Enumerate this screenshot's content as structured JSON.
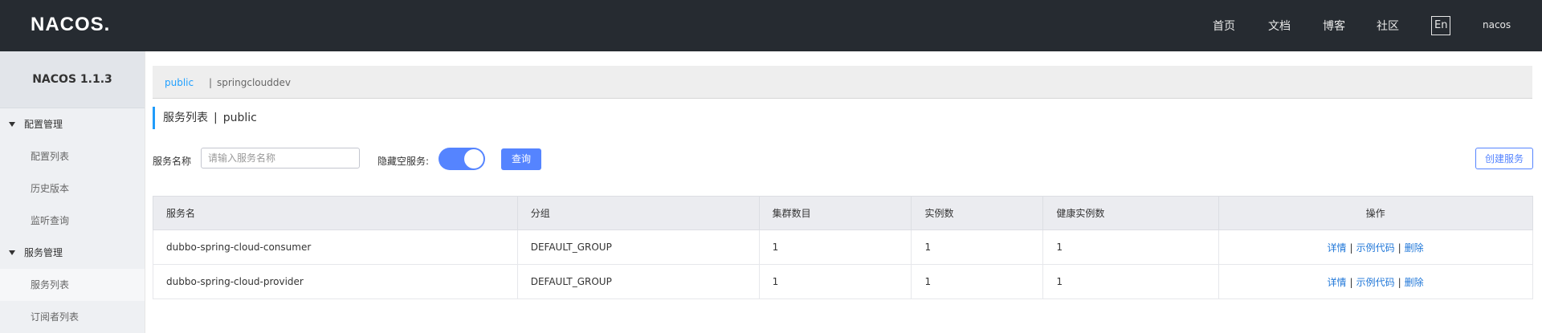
{
  "header": {
    "logo": "NACOS.",
    "nav": [
      "首页",
      "文档",
      "博客",
      "社区"
    ],
    "lang": "En",
    "user": "nacos"
  },
  "sidebar": {
    "brand": "NACOS 1.1.3",
    "groups": [
      {
        "label": "配置管理",
        "items": [
          "配置列表",
          "历史版本",
          "监听查询"
        ]
      },
      {
        "label": "服务管理",
        "items": [
          "服务列表",
          "订阅者列表"
        ]
      }
    ]
  },
  "namespace": {
    "active": "public",
    "separator": "|",
    "other": "springclouddev"
  },
  "page": {
    "title": "服务列表",
    "title_separator": "|",
    "namespace": "public"
  },
  "search": {
    "label": "服务名称",
    "placeholder": "请输入服务名称",
    "hide_empty_label": "隐藏空服务:",
    "hide_empty_on": true,
    "query_button": "查询",
    "create_button": "创建服务"
  },
  "table": {
    "columns": [
      "服务名",
      "分组",
      "集群数目",
      "实例数",
      "健康实例数",
      "操作"
    ],
    "rows": [
      {
        "name": "dubbo-spring-cloud-consumer",
        "group": "DEFAULT_GROUP",
        "clusters": "1",
        "instances": "1",
        "healthy": "1"
      },
      {
        "name": "dubbo-spring-cloud-provider",
        "group": "DEFAULT_GROUP",
        "clusters": "1",
        "instances": "1",
        "healthy": "1"
      }
    ],
    "actions": {
      "detail": "详情",
      "sample": "示例代码",
      "delete": "删除",
      "separator": "|"
    }
  },
  "colors": {
    "header_bg": "#262b31",
    "primary": "#5584ff",
    "link": "#2077d8",
    "namespace_active": "#20a0ff"
  }
}
